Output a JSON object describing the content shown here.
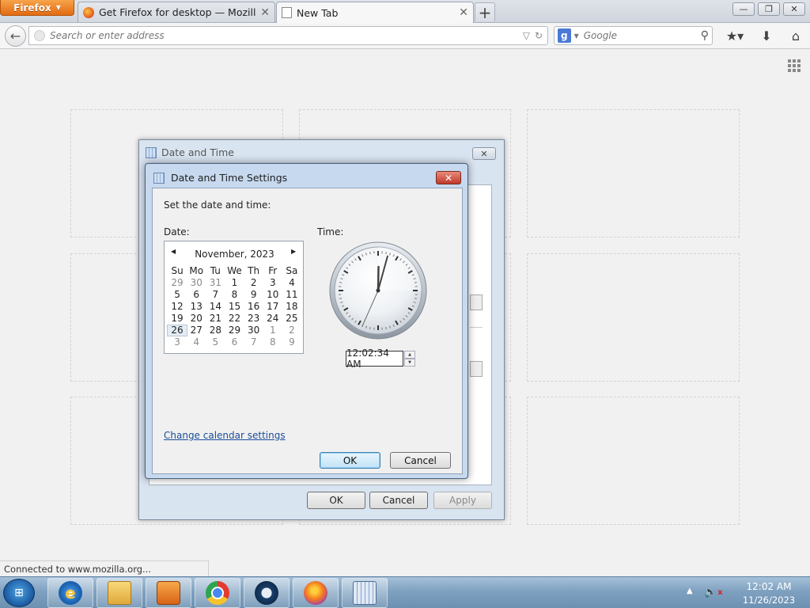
{
  "browser": {
    "menu_button": "Firefox",
    "tabs": [
      {
        "label": "Get Firefox for desktop — Mozilla (US)",
        "close": "✕"
      },
      {
        "label": "New Tab",
        "close": "✕"
      }
    ],
    "new_tab": "+",
    "window_controls": {
      "minimize": "—",
      "maximize": "❐",
      "close": "✕"
    },
    "address_placeholder": "Search or enter address",
    "search_placeholder": "Google",
    "search_engine_letter": "g",
    "status": "Connected to www.mozilla.org..."
  },
  "dialog_back": {
    "title": "Date and Time",
    "close": "✕",
    "buttons": {
      "ok": "OK",
      "cancel": "Cancel",
      "apply": "Apply"
    }
  },
  "dialog_front": {
    "title": "Date and Time Settings",
    "close": "✕",
    "prompt": "Set the date and time:",
    "date_label": "Date:",
    "time_label": "Time:",
    "calendar": {
      "month": "November, 2023",
      "prev": "◀",
      "next": "▶",
      "days_of_week": [
        "Su",
        "Mo",
        "Tu",
        "We",
        "Th",
        "Fr",
        "Sa"
      ],
      "weeks": [
        [
          "29",
          "30",
          "31",
          "1",
          "2",
          "3",
          "4"
        ],
        [
          "5",
          "6",
          "7",
          "8",
          "9",
          "10",
          "11"
        ],
        [
          "12",
          "13",
          "14",
          "15",
          "16",
          "17",
          "18"
        ],
        [
          "19",
          "20",
          "21",
          "22",
          "23",
          "24",
          "25"
        ],
        [
          "26",
          "27",
          "28",
          "29",
          "30",
          "1",
          "2"
        ],
        [
          "3",
          "4",
          "5",
          "6",
          "7",
          "8",
          "9"
        ]
      ],
      "selected_day": "26"
    },
    "clock": {
      "hour": 0,
      "minute": 2,
      "second": 34
    },
    "time_value": "12:02:34 AM",
    "spin_up": "▲",
    "spin_down": "▼",
    "change_calendar_link": "Change calendar settings",
    "buttons": {
      "ok": "OK",
      "cancel": "Cancel"
    }
  },
  "taskbar": {
    "start": "⊞",
    "apps": [
      "internet-explorer",
      "windows-explorer",
      "media-player",
      "chrome",
      "steam",
      "firefox",
      "date-and-time"
    ],
    "ie_letter": "e",
    "tray_up": "▲",
    "volume": "🔈",
    "volume_muted": "x",
    "time": "12:02 AM",
    "date": "11/26/2023"
  }
}
